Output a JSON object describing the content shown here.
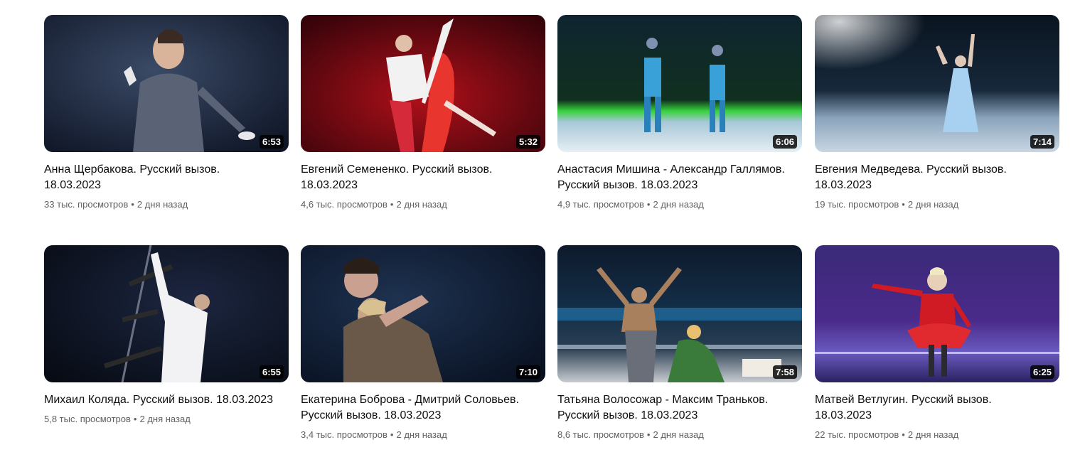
{
  "videos": [
    {
      "title": "Анна Щербакова. Русский вызов. 18.03.2023",
      "duration": "6:53",
      "views": "33 тыс. просмотров",
      "age": "2 дня назад"
    },
    {
      "title": "Евгений Семененко. Русский вызов. 18.03.2023",
      "duration": "5:32",
      "views": "4,6 тыс. просмотров",
      "age": "2 дня назад"
    },
    {
      "title": "Анастасия Мишина - Александр Галлямов. Русский вызов. 18.03.2023",
      "duration": "6:06",
      "views": "4,9 тыс. просмотров",
      "age": "2 дня назад"
    },
    {
      "title": "Евгения Медведева. Русский вызов. 18.03.2023",
      "duration": "7:14",
      "views": "19 тыс. просмотров",
      "age": "2 дня назад"
    },
    {
      "title": "Михаил Коляда. Русский вызов. 18.03.2023",
      "duration": "6:55",
      "views": "5,8 тыс. просмотров",
      "age": "2 дня назад"
    },
    {
      "title": "Екатерина Боброва - Дмитрий Соловьев. Русский вызов. 18.03.2023",
      "duration": "7:10",
      "views": "3,4 тыс. просмотров",
      "age": "2 дня назад"
    },
    {
      "title": "Татьяна Волосожар - Максим Траньков. Русский вызов. 18.03.2023",
      "duration": "7:58",
      "views": "8,6 тыс. просмотров",
      "age": "2 дня назад"
    },
    {
      "title": "Матвей Ветлугин. Русский вызов. 18.03.2023",
      "duration": "6:25",
      "views": "22 тыс. просмотров",
      "age": "2 дня назад"
    }
  ],
  "separator": "•"
}
